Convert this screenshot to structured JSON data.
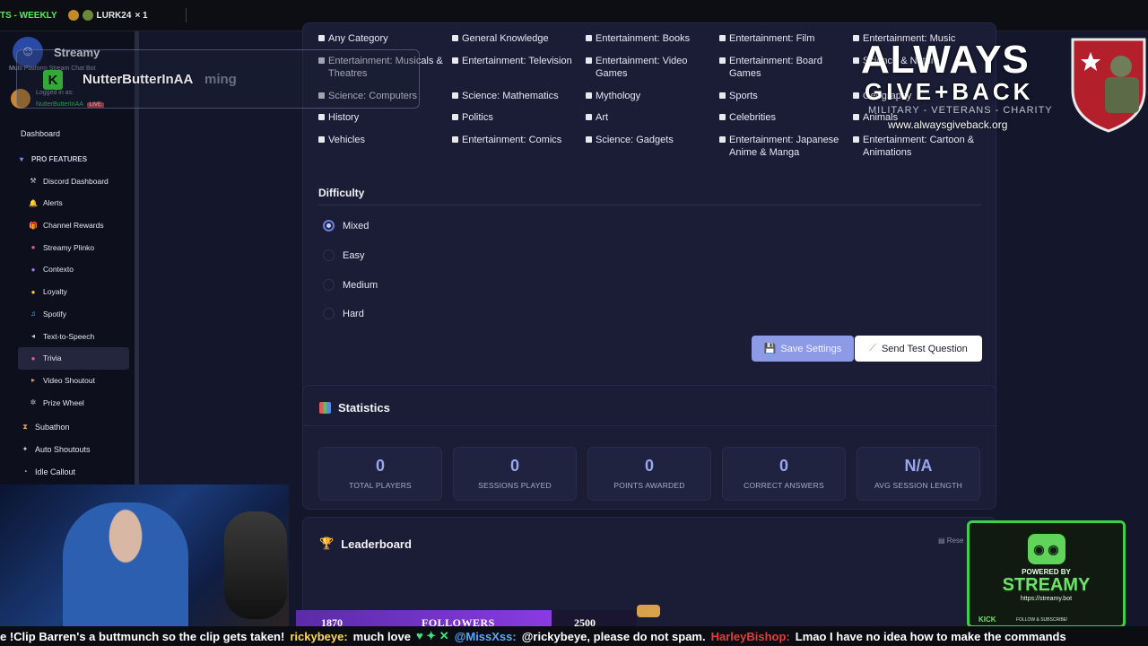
{
  "topbar": {
    "ticker_text": "TS - WEEKLY",
    "lurk_label": "LURK24",
    "lurk_count": "× 1"
  },
  "sidebar": {
    "brand": "Streamy",
    "tagline": "Multi Platform Stream Chat Bot",
    "logged_in_label": "Logged in as:",
    "username": "NutterButterInAA",
    "live_badge": "LIVE",
    "items": [
      {
        "label": "Dashboard",
        "kind": "top",
        "icon": ""
      },
      {
        "label": "PRO FEATURES",
        "kind": "section",
        "icon": "▾"
      },
      {
        "label": "Discord Dashboard",
        "kind": "sub",
        "icon": "⚒"
      },
      {
        "label": "Alerts",
        "kind": "sub",
        "icon": "🔔"
      },
      {
        "label": "Channel Rewards",
        "kind": "sub",
        "icon": "🎁"
      },
      {
        "label": "Streamy Plinko",
        "kind": "sub",
        "icon": "●"
      },
      {
        "label": "Contexto",
        "kind": "sub",
        "icon": "●"
      },
      {
        "label": "Loyalty",
        "kind": "sub",
        "icon": "●"
      },
      {
        "label": "Spotify",
        "kind": "sub",
        "icon": "♫"
      },
      {
        "label": "Text-to-Speech",
        "kind": "sub",
        "icon": "◂"
      },
      {
        "label": "Trivia",
        "kind": "sub-active",
        "icon": "●"
      },
      {
        "label": "Video Shoutout",
        "kind": "sub",
        "icon": "▸"
      },
      {
        "label": "Prize Wheel",
        "kind": "sub",
        "icon": "✲"
      },
      {
        "label": "Subathon",
        "kind": "top",
        "icon": "⧗"
      },
      {
        "label": "Auto Shoutouts",
        "kind": "top",
        "icon": "✦"
      },
      {
        "label": "Idle Callout",
        "kind": "top",
        "icon": "◔"
      }
    ]
  },
  "categories": [
    {
      "label": "Any Category",
      "col": 0,
      "row": 0
    },
    {
      "label": "General Knowledge",
      "col": 1,
      "row": 0
    },
    {
      "label": "Entertainment: Books",
      "col": 2,
      "row": 0
    },
    {
      "label": "Entertainment: Film",
      "col": 3,
      "row": 0
    },
    {
      "label": "Entertainment: Music",
      "col": 4,
      "row": 0
    },
    {
      "label": "Entertainment: Musicals & Theatres",
      "col": 0,
      "row": 1
    },
    {
      "label": "Entertainment: Television",
      "col": 1,
      "row": 1
    },
    {
      "label": "Entertainment: Video Games",
      "col": 2,
      "row": 1
    },
    {
      "label": "Entertainment: Board Games",
      "col": 3,
      "row": 1
    },
    {
      "label": "Science & Nature",
      "col": 4,
      "row": 1
    },
    {
      "label": "Science: Computers",
      "col": 0,
      "row": 2
    },
    {
      "label": "Science: Mathematics",
      "col": 1,
      "row": 2
    },
    {
      "label": "Mythology",
      "col": 2,
      "row": 2
    },
    {
      "label": "Sports",
      "col": 3,
      "row": 2
    },
    {
      "label": "Geography",
      "col": 4,
      "row": 2
    },
    {
      "label": "History",
      "col": 0,
      "row": 3
    },
    {
      "label": "Politics",
      "col": 1,
      "row": 3
    },
    {
      "label": "Art",
      "col": 2,
      "row": 3
    },
    {
      "label": "Celebrities",
      "col": 3,
      "row": 3
    },
    {
      "label": "Animals",
      "col": 4,
      "row": 3
    },
    {
      "label": "Vehicles",
      "col": 0,
      "row": 4
    },
    {
      "label": "Entertainment: Comics",
      "col": 1,
      "row": 4
    },
    {
      "label": "Science: Gadgets",
      "col": 2,
      "row": 4
    },
    {
      "label": "Entertainment: Japanese Anime & Manga",
      "col": 3,
      "row": 4
    },
    {
      "label": "Entertainment: Cartoon & Animations",
      "col": 4,
      "row": 4
    }
  ],
  "difficulty": {
    "title": "Difficulty",
    "options": [
      "Mixed",
      "Easy",
      "Medium",
      "Hard"
    ],
    "selected": "Mixed"
  },
  "buttons": {
    "save": "Save Settings",
    "test": "Send Test Question"
  },
  "statistics": {
    "title": "Statistics",
    "items": [
      {
        "value": "0",
        "label": "TOTAL PLAYERS"
      },
      {
        "value": "0",
        "label": "SESSIONS PLAYED"
      },
      {
        "value": "0",
        "label": "POINTS AWARDED"
      },
      {
        "value": "0",
        "label": "CORRECT ANSWERS"
      },
      {
        "value": "N/A",
        "label": "AVG SESSION LENGTH"
      }
    ]
  },
  "leaderboard": {
    "title": "Leaderboard",
    "reset_label": "Rese"
  },
  "overlay": {
    "follower_name": "NutterButterInAA",
    "follower_ghost": "ming",
    "charity_line1": "ALWAYS",
    "charity_line2": "GIVE+BACK",
    "charity_line3": "MILITARY - VETERANS - CHARITY",
    "charity_url": "www.alwaysgiveback.org",
    "powered_by": "POWERED BY",
    "streamy_name": "STREAMY",
    "streamy_url": "https://streamy.bot",
    "kick_label": "KICK",
    "follow_sub": "FOLLOW & SUBSCRIBE!",
    "goal_current": "1870",
    "goal_label": "FOLLOWERS",
    "goal_target": "2500"
  },
  "chat": {
    "msg1": "e !Clip Barren's a buttmunch so the clip gets taken!",
    "user2": "rickybeye:",
    "msg2": "much love",
    "user3": "@MissXss:",
    "msg3": "@rickybeye, please do not spam.",
    "user4": "HarleyBishop:",
    "msg4": "Lmao I have no idea how to make the commands"
  },
  "colors": {
    "accent": "#8d9ae6",
    "stat_value": "#9aa6ef",
    "card_bg": "#1a1d35",
    "page_bg": "#14172c"
  }
}
